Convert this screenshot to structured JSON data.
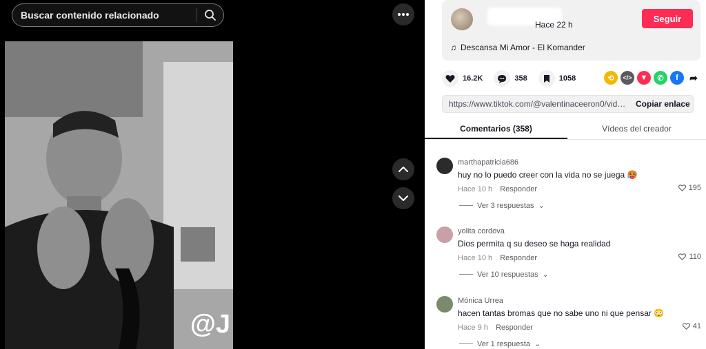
{
  "search": {
    "placeholder": "Buscar contenido relacionado"
  },
  "video": {
    "watermark": "@J"
  },
  "post": {
    "time": "Hace 22 h",
    "follow_label": "Seguir",
    "music": "Descansa Mi Amor - El Komander"
  },
  "actions": {
    "likes": "16.2K",
    "comments": "358",
    "saves": "1058"
  },
  "share": {
    "link": "https://www.tiktok.com/@valentinaceeron0/video/...",
    "copy_label": "Copiar enlace"
  },
  "tabs": {
    "comments": "Comentarios (358)",
    "creator": "Vídeos del creador"
  },
  "comments": [
    {
      "user": "marthapatricia686",
      "text": "huy no lo puedo creer con la vida no se juega 🥵",
      "time": "Hace 10 h",
      "reply": "Responder",
      "likes": "195",
      "more": "Ver 3 respuestas"
    },
    {
      "user": "yolita cordova",
      "text": "Dios permita q su deseo se haga realidad",
      "time": "Hace 10 h",
      "reply": "Responder",
      "likes": "110",
      "more": "Ver 10 respuestas"
    },
    {
      "user": "Mónica Urrea",
      "text": "hacen tantas bromas que no sabe uno ni que pensar 😳",
      "time": "Hace 9 h",
      "reply": "Responder",
      "likes": "41",
      "more": "Ver 1 respuesta"
    }
  ],
  "colors": {
    "accent": "#fe2c55",
    "text": "#161823",
    "muted": "#8a8b91"
  }
}
